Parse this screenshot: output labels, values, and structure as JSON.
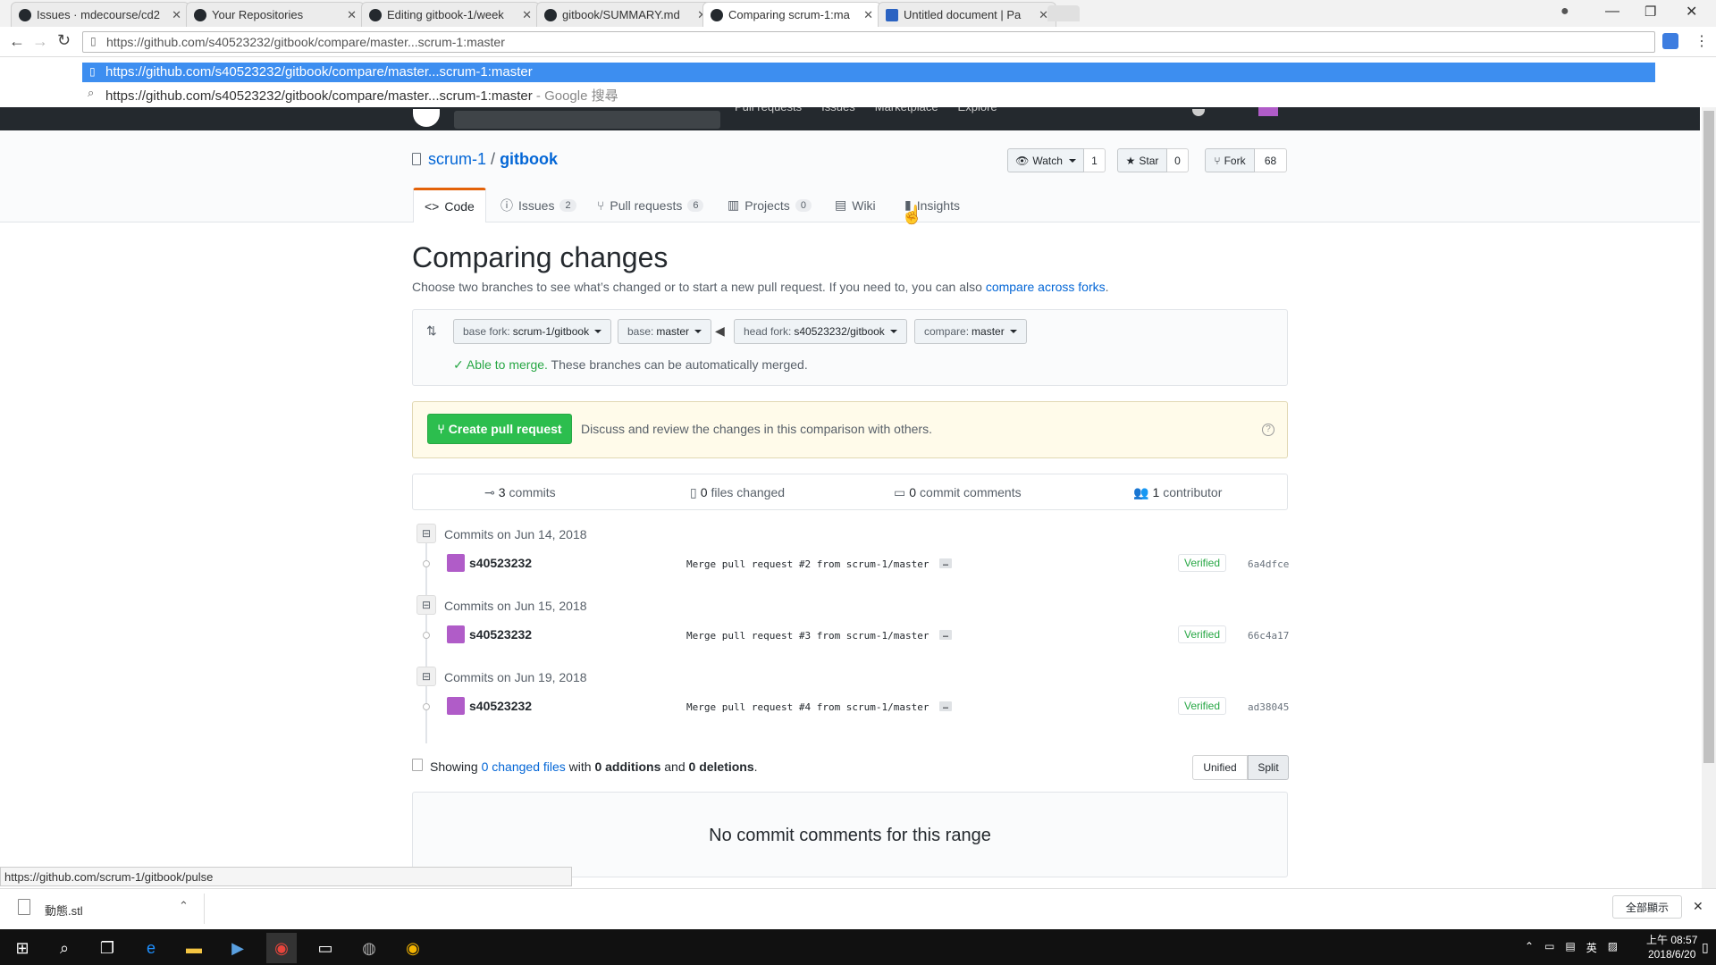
{
  "browser": {
    "tabs": [
      {
        "title": "Issues · mdecourse/cd2",
        "favicon": "github-icon"
      },
      {
        "title": "Your Repositories",
        "favicon": "github-icon"
      },
      {
        "title": "Editing gitbook-1/week",
        "favicon": "github-icon"
      },
      {
        "title": "gitbook/SUMMARY.md",
        "favicon": "github-icon"
      },
      {
        "title": "Comparing scrum-1:ma",
        "favicon": "github-icon"
      },
      {
        "title": "Untitled document | Pa",
        "favicon": "document-icon"
      }
    ],
    "address": "https://github.com/s40523232/gitbook/compare/master...scrum-1:master",
    "suggestions": {
      "first": "https://github.com/s40523232/gitbook/compare/master...scrum-1:master",
      "second": "https://github.com/s40523232/gitbook/compare/master...scrum-1:master",
      "second_suffix": " - Google 搜尋"
    }
  },
  "github_header": {
    "nav": [
      "Pull requests",
      "Issues",
      "Marketplace",
      "Explore"
    ]
  },
  "repo": {
    "owner": "scrum-1",
    "sep": "/",
    "name": "gitbook",
    "watch_label": "Watch",
    "watch_count": "1",
    "star_label": "Star",
    "star_count": "0",
    "fork_label": "Fork",
    "fork_count": "68",
    "tabs": [
      {
        "label": "Code",
        "count": ""
      },
      {
        "label": "Issues",
        "count": "2"
      },
      {
        "label": "Pull requests",
        "count": "6"
      },
      {
        "label": "Projects",
        "count": "0"
      },
      {
        "label": "Wiki",
        "count": ""
      },
      {
        "label": "Insights",
        "count": ""
      }
    ]
  },
  "compare": {
    "title": "Comparing changes",
    "desc": "Choose two branches to see what’s changed or to start a new pull request. If you need to, you can also ",
    "desc_link": "compare across forks",
    "desc_end": ".",
    "base_fork_label": "base fork: ",
    "base_fork_value": "scrum-1/gitbook",
    "base_label": "base: ",
    "base_value": "master",
    "head_fork_label": "head fork: ",
    "head_fork_value": "s40523232/gitbook",
    "compare_label": "compare: ",
    "compare_value": "master",
    "merge_status": "Able to merge.",
    "merge_note": " These branches can be automatically merged.",
    "create_pr": "Create pull request",
    "pr_desc": "Discuss and review the changes in this comparison with others."
  },
  "stats": {
    "commits_num": "3",
    "commits_label": " commits",
    "files_num": "0",
    "files_label": " files changed",
    "comments_num": "0",
    "comments_label": " commit comments",
    "contributors_num": "1",
    "contributors_label": " contributor"
  },
  "commit_groups": [
    {
      "date": "Commits on Jun 14, 2018",
      "author": "s40523232",
      "message": "Merge pull request #2 from scrum-1/master",
      "ellipsis": "…",
      "verified": "Verified",
      "sha": "6a4dfce"
    },
    {
      "date": "Commits on Jun 15, 2018",
      "author": "s40523232",
      "message": "Merge pull request #3 from scrum-1/master",
      "ellipsis": "…",
      "verified": "Verified",
      "sha": "66c4a17"
    },
    {
      "date": "Commits on Jun 19, 2018",
      "author": "s40523232",
      "message": "Merge pull request #4 from scrum-1/master",
      "ellipsis": "…",
      "verified": "Verified",
      "sha": "ad38045"
    }
  ],
  "summary": {
    "showing": "Showing ",
    "changed_files": "0 changed files",
    "with": " with ",
    "additions": "0 additions",
    "and": " and ",
    "deletions": "0 deletions",
    "end": ".",
    "unified": "Unified",
    "split": "Split"
  },
  "no_comments": "No commit comments for this range",
  "status_url": "https://github.com/scrum-1/gitbook/pulse",
  "downloads": {
    "file": "動態.stl",
    "show_all": "全部顯示"
  },
  "taskbar": {
    "time": "上午 08:57",
    "date": "2018/6/20",
    "ime": "英"
  }
}
